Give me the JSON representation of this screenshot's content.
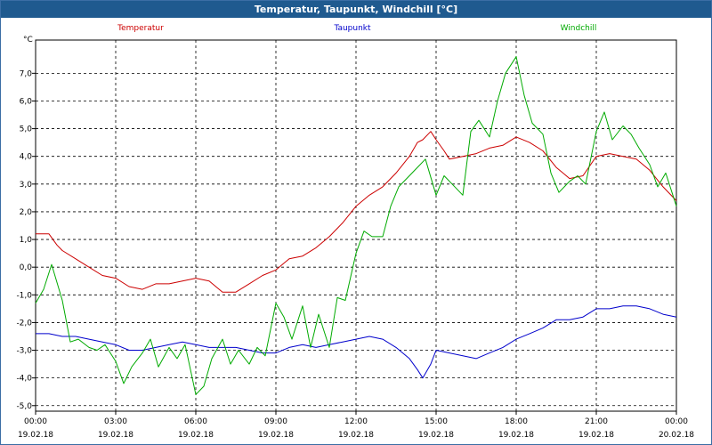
{
  "window": {
    "title": "Temperatur, Taupunkt, Windchill [°C]"
  },
  "chart_data": {
    "type": "line",
    "unit": "°C",
    "ylim": [
      -5.2,
      8.2
    ],
    "y_ticks": [
      -5,
      -4,
      -3,
      -2,
      -1,
      0,
      1,
      2,
      3,
      4,
      5,
      6,
      7
    ],
    "y_tick_labels": [
      "-5,0",
      "-4,0",
      "-3,0",
      "-2,0",
      "-1,0",
      "0,0",
      "1,0",
      "2,0",
      "3,0",
      "4,0",
      "5,0",
      "6,0",
      "7,0"
    ],
    "xlim": [
      0,
      24
    ],
    "x_ticks": [
      0,
      3,
      6,
      9,
      12,
      15,
      18,
      21,
      24
    ],
    "x_tick_time_labels": [
      "00:00",
      "03:00",
      "06:00",
      "09:00",
      "12:00",
      "15:00",
      "18:00",
      "21:00",
      "00:00"
    ],
    "x_tick_date_labels": [
      "19.02.18",
      "19.02.18",
      "19.02.18",
      "19.02.18",
      "19.02.18",
      "19.02.18",
      "19.02.18",
      "19.02.18",
      "20.02.18"
    ],
    "grid": true,
    "legend": "top",
    "series": [
      {
        "name": "Temperatur",
        "color": "#cc0000",
        "x": [
          0,
          0.5,
          0.8,
          1.0,
          1.5,
          2.0,
          2.5,
          3.0,
          3.5,
          4.0,
          4.5,
          5.0,
          5.5,
          6.0,
          6.5,
          7.0,
          7.5,
          8.0,
          8.5,
          9.0,
          9.5,
          10.0,
          10.5,
          11.0,
          11.5,
          12.0,
          12.5,
          13.0,
          13.5,
          14.0,
          14.3,
          14.5,
          14.8,
          15.0,
          15.3,
          15.5,
          16.0,
          16.5,
          17.0,
          17.5,
          18.0,
          18.5,
          19.0,
          19.5,
          20.0,
          20.5,
          21.0,
          21.5,
          22.0,
          22.5,
          23.0,
          23.5,
          24.0
        ],
        "y": [
          1.2,
          1.2,
          0.8,
          0.6,
          0.3,
          0.0,
          -0.3,
          -0.4,
          -0.7,
          -0.8,
          -0.6,
          -0.6,
          -0.5,
          -0.4,
          -0.5,
          -0.9,
          -0.9,
          -0.6,
          -0.3,
          -0.1,
          0.3,
          0.4,
          0.7,
          1.1,
          1.6,
          2.2,
          2.6,
          2.9,
          3.4,
          4.0,
          4.5,
          4.6,
          4.9,
          4.6,
          4.2,
          3.9,
          4.0,
          4.1,
          4.3,
          4.4,
          4.7,
          4.5,
          4.2,
          3.6,
          3.2,
          3.3,
          4.0,
          4.1,
          4.0,
          3.9,
          3.5,
          2.9,
          2.4
        ]
      },
      {
        "name": "Taupunkt",
        "color": "#0000cc",
        "x": [
          0,
          0.5,
          1.0,
          1.5,
          2.0,
          2.5,
          3.0,
          3.5,
          4.0,
          4.5,
          5.0,
          5.5,
          6.0,
          6.5,
          7.0,
          7.5,
          8.0,
          8.5,
          9.0,
          9.5,
          10.0,
          10.5,
          11.0,
          11.5,
          12.0,
          12.5,
          13.0,
          13.5,
          14.0,
          14.3,
          14.5,
          14.8,
          15.0,
          15.5,
          16.0,
          16.5,
          17.0,
          17.5,
          18.0,
          18.5,
          19.0,
          19.5,
          20.0,
          20.5,
          21.0,
          21.5,
          22.0,
          22.5,
          23.0,
          23.5,
          24.0
        ],
        "y": [
          -2.4,
          -2.4,
          -2.5,
          -2.5,
          -2.6,
          -2.7,
          -2.8,
          -3.0,
          -3.0,
          -2.9,
          -2.8,
          -2.7,
          -2.8,
          -2.9,
          -2.9,
          -2.9,
          -3.0,
          -3.1,
          -3.1,
          -2.9,
          -2.8,
          -2.9,
          -2.8,
          -2.7,
          -2.6,
          -2.5,
          -2.6,
          -2.9,
          -3.3,
          -3.7,
          -4.0,
          -3.5,
          -3.0,
          -3.1,
          -3.2,
          -3.3,
          -3.1,
          -2.9,
          -2.6,
          -2.4,
          -2.2,
          -1.9,
          -1.9,
          -1.8,
          -1.5,
          -1.5,
          -1.4,
          -1.4,
          -1.5,
          -1.7,
          -1.8
        ]
      },
      {
        "name": "Windchill",
        "color": "#00aa00",
        "x": [
          0,
          0.3,
          0.6,
          1.0,
          1.3,
          1.6,
          2.0,
          2.3,
          2.6,
          3.0,
          3.3,
          3.6,
          4.0,
          4.3,
          4.6,
          5.0,
          5.3,
          5.6,
          6.0,
          6.3,
          6.6,
          7.0,
          7.3,
          7.6,
          8.0,
          8.3,
          8.6,
          9.0,
          9.3,
          9.6,
          10.0,
          10.3,
          10.6,
          11.0,
          11.3,
          11.6,
          12.0,
          12.3,
          12.6,
          13.0,
          13.3,
          13.6,
          14.0,
          14.3,
          14.6,
          15.0,
          15.3,
          15.6,
          16.0,
          16.3,
          16.6,
          17.0,
          17.3,
          17.6,
          18.0,
          18.3,
          18.6,
          19.0,
          19.3,
          19.6,
          20.0,
          20.3,
          20.6,
          21.0,
          21.3,
          21.6,
          22.0,
          22.3,
          22.6,
          23.0,
          23.3,
          23.6,
          24.0
        ],
        "y": [
          -1.3,
          -0.8,
          0.1,
          -1.2,
          -2.7,
          -2.6,
          -2.9,
          -3.0,
          -2.8,
          -3.4,
          -4.2,
          -3.6,
          -3.1,
          -2.6,
          -3.6,
          -2.9,
          -3.3,
          -2.8,
          -4.6,
          -4.3,
          -3.3,
          -2.6,
          -3.5,
          -3.0,
          -3.5,
          -2.9,
          -3.2,
          -1.3,
          -1.8,
          -2.6,
          -1.4,
          -2.9,
          -1.7,
          -2.9,
          -1.1,
          -1.2,
          0.5,
          1.3,
          1.1,
          1.1,
          2.2,
          2.9,
          3.3,
          3.6,
          3.9,
          2.6,
          3.3,
          3.0,
          2.6,
          4.9,
          5.3,
          4.7,
          6.0,
          7.0,
          7.6,
          6.2,
          5.2,
          4.8,
          3.4,
          2.7,
          3.1,
          3.3,
          3.0,
          4.9,
          5.6,
          4.6,
          5.1,
          4.8,
          4.3,
          3.7,
          2.9,
          3.4,
          2.2
        ]
      }
    ]
  }
}
